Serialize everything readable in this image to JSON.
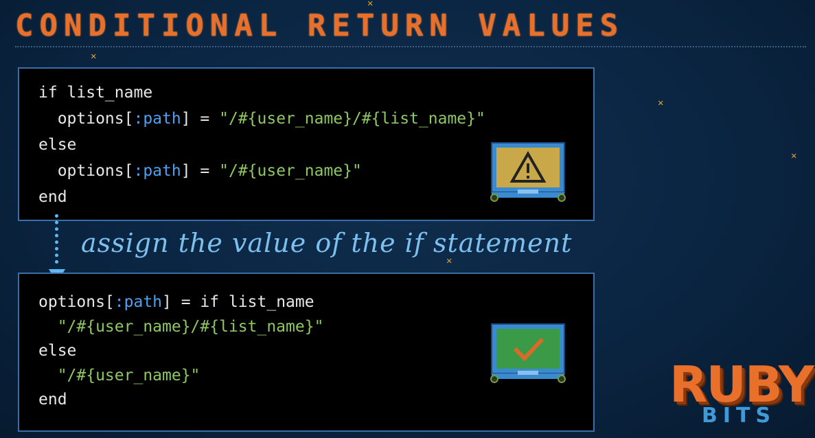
{
  "slide": {
    "title": "CONDITIONAL RETURN VALUES",
    "annotation": "assign the value of the if statement",
    "logo": {
      "main": "RUBY",
      "sub": "BITS"
    }
  },
  "top_code": {
    "lines": [
      [
        {
          "t": "if list_name",
          "c": "plain"
        }
      ],
      [
        {
          "t": "  options[",
          "c": "plain"
        },
        {
          "t": ":path",
          "c": "sym"
        },
        {
          "t": "] = ",
          "c": "plain"
        },
        {
          "t": "\"/#{user_name}/#{list_name}\"",
          "c": "str"
        }
      ],
      [
        {
          "t": "else",
          "c": "plain"
        }
      ],
      [
        {
          "t": "  options[",
          "c": "plain"
        },
        {
          "t": ":path",
          "c": "sym"
        },
        {
          "t": "] = ",
          "c": "plain"
        },
        {
          "t": "\"/#{user_name}\"",
          "c": "str"
        }
      ],
      [
        {
          "t": "end",
          "c": "plain"
        }
      ]
    ],
    "badge_icon": "warning-monitor-icon"
  },
  "bottom_code": {
    "lines": [
      [
        {
          "t": "options[",
          "c": "plain"
        },
        {
          "t": ":path",
          "c": "sym"
        },
        {
          "t": "] = if list_name",
          "c": "plain"
        }
      ],
      [
        {
          "t": "  \"/#{user_name}/#{list_name}\"",
          "c": "str"
        }
      ],
      [
        {
          "t": "else",
          "c": "plain"
        }
      ],
      [
        {
          "t": "  \"/#{user_name}\"",
          "c": "str"
        }
      ],
      [
        {
          "t": "end",
          "c": "plain"
        }
      ]
    ],
    "badge_icon": "checkmark-monitor-icon"
  },
  "colors": {
    "title": "#e8702a",
    "symbol": "#4ea0f0",
    "string": "#8ec860",
    "annotation": "#7cc0f0",
    "warning_panel": "#c8a848",
    "ok_panel": "#3a9a48"
  }
}
